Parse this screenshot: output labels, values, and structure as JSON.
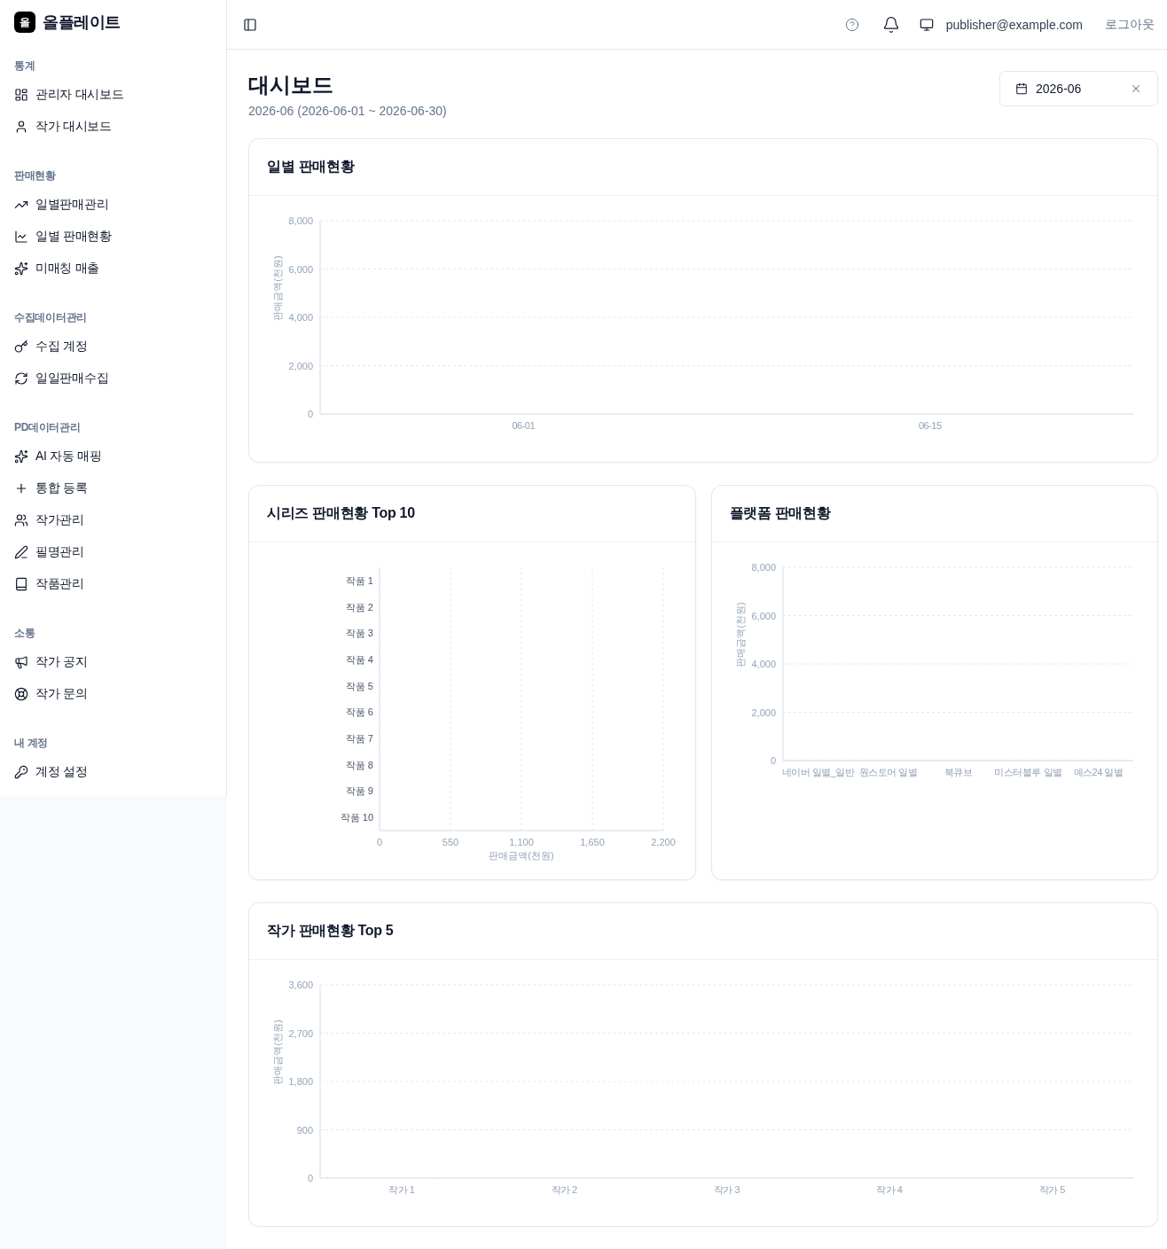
{
  "sidebar": {
    "logo": {
      "mark": "올",
      "name": "올플레이트"
    },
    "sections": [
      {
        "title": "통계",
        "items": [
          "관리자 대시보드",
          "작가 대시보드"
        ]
      },
      {
        "title": "판매현황",
        "items": [
          "일별판매관리",
          "일별 판매현황",
          "미매칭 매출"
        ]
      },
      {
        "title": "수집데이터관리",
        "items": [
          "수집 계정",
          "일일판매수집"
        ]
      },
      {
        "title": "PD데이터관리",
        "items": [
          "AI 자동 매핑",
          "통합 등록",
          "작가관리",
          "필명관리",
          "작품관리"
        ]
      },
      {
        "title": "소통",
        "items": [
          "작가 공지",
          "작가 문의"
        ]
      },
      {
        "title": "내 계정",
        "items": [
          "계정 설정"
        ]
      }
    ]
  },
  "topbar": {
    "user_email": "publisher@example.com",
    "logout": "로그아웃"
  },
  "page_header": {
    "title": "대시보드",
    "subtitle": "2026-06 (2026-06-01 ~ 2026-06-30)",
    "month_picker": {
      "value": "2026-06"
    }
  },
  "rows": [
    {
      "cards": [
        {
          "chart_data": {
            "type": "bar",
            "orientation": "vertical",
            "title": "일별 판매현황",
            "ylabel": "판매금액(천원)",
            "categories": [
              "06-01",
              "06-15"
            ],
            "values": [
              null,
              null
            ],
            "ylim": [
              0,
              8000
            ],
            "yticks": [
              {
                "value": 0,
                "label": "0"
              },
              {
                "value": 2000,
                "label": "2,000"
              },
              {
                "value": 4000,
                "label": "4,000"
              },
              {
                "value": 6000,
                "label": "6,000"
              },
              {
                "value": 8000,
                "label": "8,000"
              }
            ],
            "grid": true
          }
        }
      ]
    },
    {
      "cards": [
        {
          "chart_data": {
            "type": "bar",
            "orientation": "horizontal",
            "title": "시리즈 판매현황 Top 10",
            "xlabel": "판매금액(천원)",
            "categories": [
              "작품 1",
              "작품 2",
              "작품 3",
              "작품 4",
              "작품 5",
              "작품 6",
              "작품 7",
              "작품 8",
              "작품 9",
              "작품 10"
            ],
            "values": [
              null,
              null,
              null,
              null,
              null,
              null,
              null,
              null,
              null,
              null
            ],
            "xlim": [
              0,
              2200
            ],
            "xticks": [
              {
                "value": 0,
                "label": "0"
              },
              {
                "value": 550,
                "label": "550"
              },
              {
                "value": 1100,
                "label": "1,100"
              },
              {
                "value": 1650,
                "label": "1,650"
              },
              {
                "value": 2200,
                "label": "2,200"
              }
            ],
            "grid": true
          }
        },
        {
          "chart_data": {
            "type": "bar",
            "orientation": "vertical",
            "title": "플랫폼 판매현황",
            "ylabel": "판매금액(천원)",
            "categories": [
              "네이버 일별_일반",
              "원스토어 일별",
              "북큐브",
              "미스터블루 일별",
              "예스24 일별"
            ],
            "values": [
              null,
              null,
              null,
              null,
              null
            ],
            "ylim": [
              0,
              8000
            ],
            "yticks": [
              {
                "value": 0,
                "label": "0"
              },
              {
                "value": 2000,
                "label": "2,000"
              },
              {
                "value": 4000,
                "label": "4,000"
              },
              {
                "value": 6000,
                "label": "6,000"
              },
              {
                "value": 8000,
                "label": "8,000"
              }
            ],
            "grid": true
          }
        }
      ]
    },
    {
      "cards": [
        {
          "chart_data": {
            "type": "bar",
            "orientation": "vertical",
            "title": "작가 판매현황 Top 5",
            "ylabel": "판매금액(천원)",
            "categories": [
              "작가 1",
              "작가 2",
              "작가 3",
              "작가 4",
              "작가 5"
            ],
            "values": [
              null,
              null,
              null,
              null,
              null
            ],
            "ylim": [
              0,
              3600
            ],
            "yticks": [
              {
                "value": 0,
                "label": "0"
              },
              {
                "value": 900,
                "label": "900"
              },
              {
                "value": 1800,
                "label": "1,800"
              },
              {
                "value": 2700,
                "label": "2,700"
              },
              {
                "value": 3600,
                "label": "3,600"
              }
            ],
            "grid": true
          }
        }
      ]
    }
  ]
}
